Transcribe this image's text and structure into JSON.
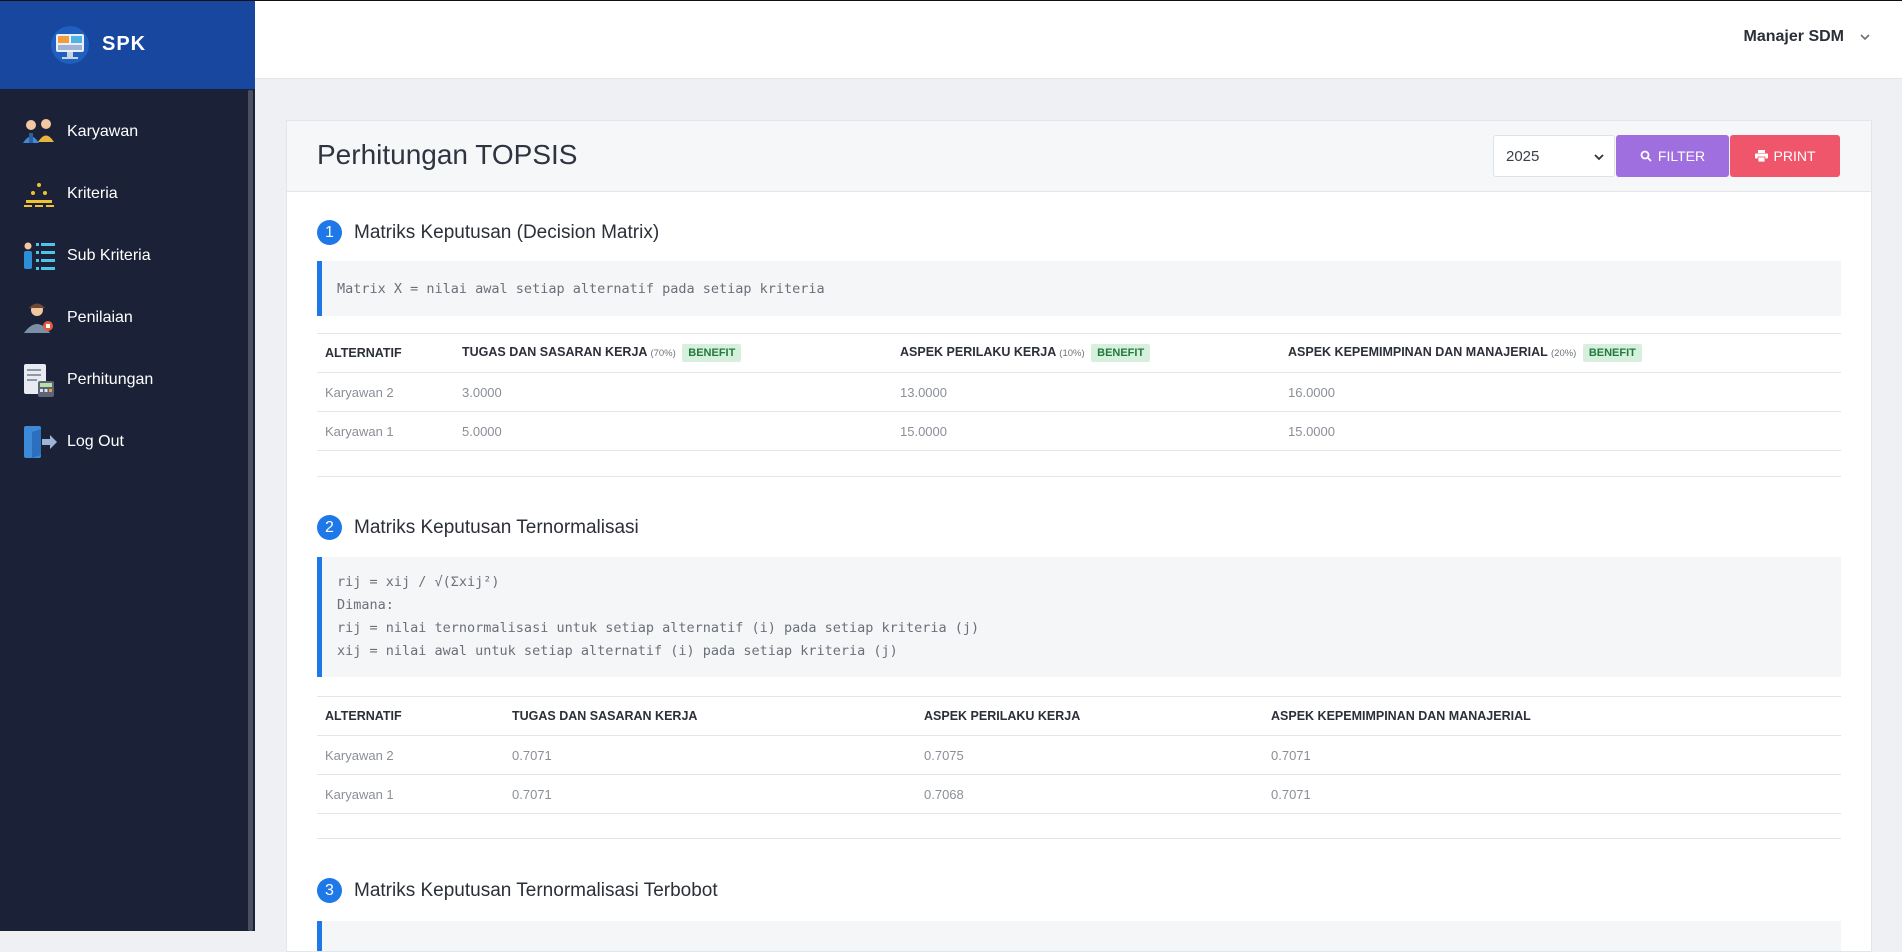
{
  "brand": {
    "name": "SPK"
  },
  "sidebar": {
    "items": [
      {
        "label": "Karyawan",
        "icon": "employees-icon"
      },
      {
        "label": "Kriteria",
        "icon": "criteria-icon"
      },
      {
        "label": "Sub Kriteria",
        "icon": "sub-criteria-icon"
      },
      {
        "label": "Penilaian",
        "icon": "assessment-icon"
      },
      {
        "label": "Perhitungan",
        "icon": "calculation-icon"
      },
      {
        "label": "Log Out",
        "icon": "logout-icon"
      }
    ]
  },
  "header": {
    "user": "Manajer SDM"
  },
  "page": {
    "title": "Perhitungan TOPSIS",
    "year": "2025",
    "filter_label": "FILTER",
    "print_label": "PRINT"
  },
  "colors": {
    "sidebar": "#1b2238",
    "brand": "#17479e",
    "accent": "#1e78e8",
    "filter": "#9f6fe0",
    "print": "#f0566b",
    "badge": "#d7f0de"
  },
  "sections": [
    {
      "number": "1",
      "title": "Matriks Keputusan (Decision Matrix)",
      "formula": [
        "Matrix X = nilai awal setiap alternatif pada setiap kriteria"
      ],
      "headers": [
        "ALTERNATIF",
        "TUGAS DAN SASARAN KERJA",
        "ASPEK PERILAKU KERJA",
        "ASPEK KEPEMIMPINAN DAN MANAJERIAL"
      ],
      "weights": [
        "(70%)",
        "(10%)",
        "(20%)"
      ],
      "types": [
        "BENEFIT",
        "BENEFIT",
        "BENEFIT"
      ],
      "rows": [
        [
          "Karyawan 2",
          "3.0000",
          "13.0000",
          "16.0000"
        ],
        [
          "Karyawan 1",
          "5.0000",
          "15.0000",
          "15.0000"
        ]
      ]
    },
    {
      "number": "2",
      "title": "Matriks Keputusan Ternormalisasi",
      "formula": [
        "rij = xij / √(Σxij²)",
        "Dimana:",
        "rij = nilai ternormalisasi untuk setiap alternatif (i) pada setiap kriteria (j)",
        "xij = nilai awal untuk setiap alternatif (i) pada setiap kriteria (j)"
      ],
      "headers": [
        "ALTERNATIF",
        "TUGAS DAN SASARAN KERJA",
        "ASPEK PERILAKU KERJA",
        "ASPEK KEPEMIMPINAN DAN MANAJERIAL"
      ],
      "rows": [
        [
          "Karyawan 2",
          "0.7071",
          "0.7075",
          "0.7071"
        ],
        [
          "Karyawan 1",
          "0.7071",
          "0.7068",
          "0.7071"
        ]
      ]
    },
    {
      "number": "3",
      "title": "Matriks Keputusan Ternormalisasi Terbobot"
    }
  ]
}
